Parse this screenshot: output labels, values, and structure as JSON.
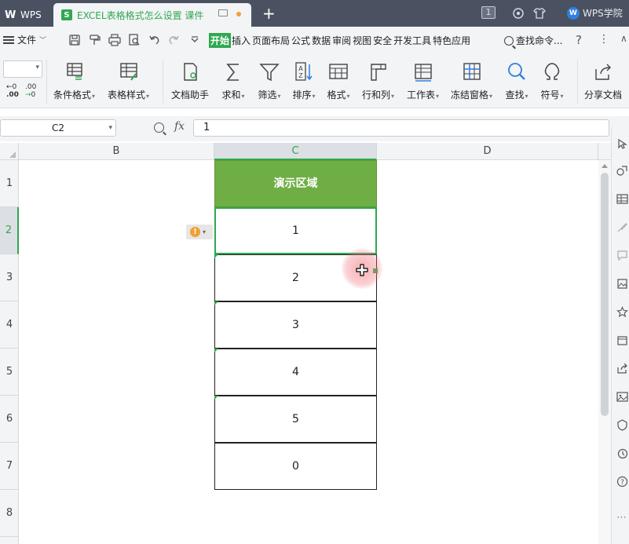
{
  "titlebar": {
    "app_tab": "WPS",
    "doc_tab_title": "EXCEL表格格式怎么设置 课件",
    "doc_icon_letter": "S",
    "new_tab": "+",
    "badge": "1",
    "academy": "WPS学院",
    "academy_logo_letter": "W"
  },
  "menubar": {
    "file_label": "文件",
    "file_chevron": "﹀",
    "quick_access": [
      "save-icon",
      "format-painter-icon",
      "print-icon",
      "print-preview-icon",
      "undo-icon",
      "redo-icon",
      "customize-icon"
    ],
    "tabs": [
      {
        "label": "开始",
        "active": true
      },
      {
        "label": "插入"
      },
      {
        "label": "页面布局"
      },
      {
        "label": "公式"
      },
      {
        "label": "数据"
      },
      {
        "label": "审阅"
      },
      {
        "label": "视图"
      },
      {
        "label": "安全"
      },
      {
        "label": "开发工具"
      },
      {
        "label": "特色应用"
      }
    ],
    "search_label": "查找命令...",
    "help": "?",
    "more": "⋮"
  },
  "ribbon": {
    "decimal_increase": "←0\n.00",
    "decimal_decrease": ".00\n→0",
    "buttons": [
      {
        "label": "条件格式",
        "icon": "conditional-format-icon"
      },
      {
        "label": "表格样式",
        "icon": "table-style-icon"
      },
      {
        "label": "文档助手",
        "icon": "doc-assistant-icon"
      },
      {
        "label": "求和",
        "icon": "sum-icon"
      },
      {
        "label": "筛选",
        "icon": "filter-icon"
      },
      {
        "label": "排序",
        "icon": "sort-icon"
      },
      {
        "label": "格式",
        "icon": "format-icon"
      },
      {
        "label": "行和列",
        "icon": "row-col-icon"
      },
      {
        "label": "工作表",
        "icon": "worksheet-icon"
      },
      {
        "label": "冻结窗格",
        "icon": "freeze-pane-icon"
      },
      {
        "label": "查找",
        "icon": "find-icon"
      },
      {
        "label": "符号",
        "icon": "symbol-icon"
      },
      {
        "label": "分享文档",
        "icon": "share-icon"
      }
    ]
  },
  "formula_bar": {
    "name_box": "C2",
    "fx": "fx",
    "value": "1"
  },
  "grid": {
    "columns": [
      "B",
      "C",
      "D"
    ],
    "selected_column": "C",
    "rows": [
      "1",
      "2",
      "3",
      "4",
      "5",
      "6",
      "7",
      "8"
    ],
    "selected_row": "2",
    "cells": [
      {
        "row": "1",
        "value": "演示区域",
        "header": true
      },
      {
        "row": "2",
        "value": "1",
        "active": true
      },
      {
        "row": "3",
        "value": "2"
      },
      {
        "row": "4",
        "value": "3"
      },
      {
        "row": "5",
        "value": "4"
      },
      {
        "row": "6",
        "value": "5"
      },
      {
        "row": "7",
        "value": "0"
      }
    ],
    "warning_icon": "!",
    "warning_dropdown": "▾"
  },
  "colors": {
    "accent_green": "#2fa84f",
    "header_cell_green": "#6fae44",
    "titlebar": "#4a5262"
  }
}
